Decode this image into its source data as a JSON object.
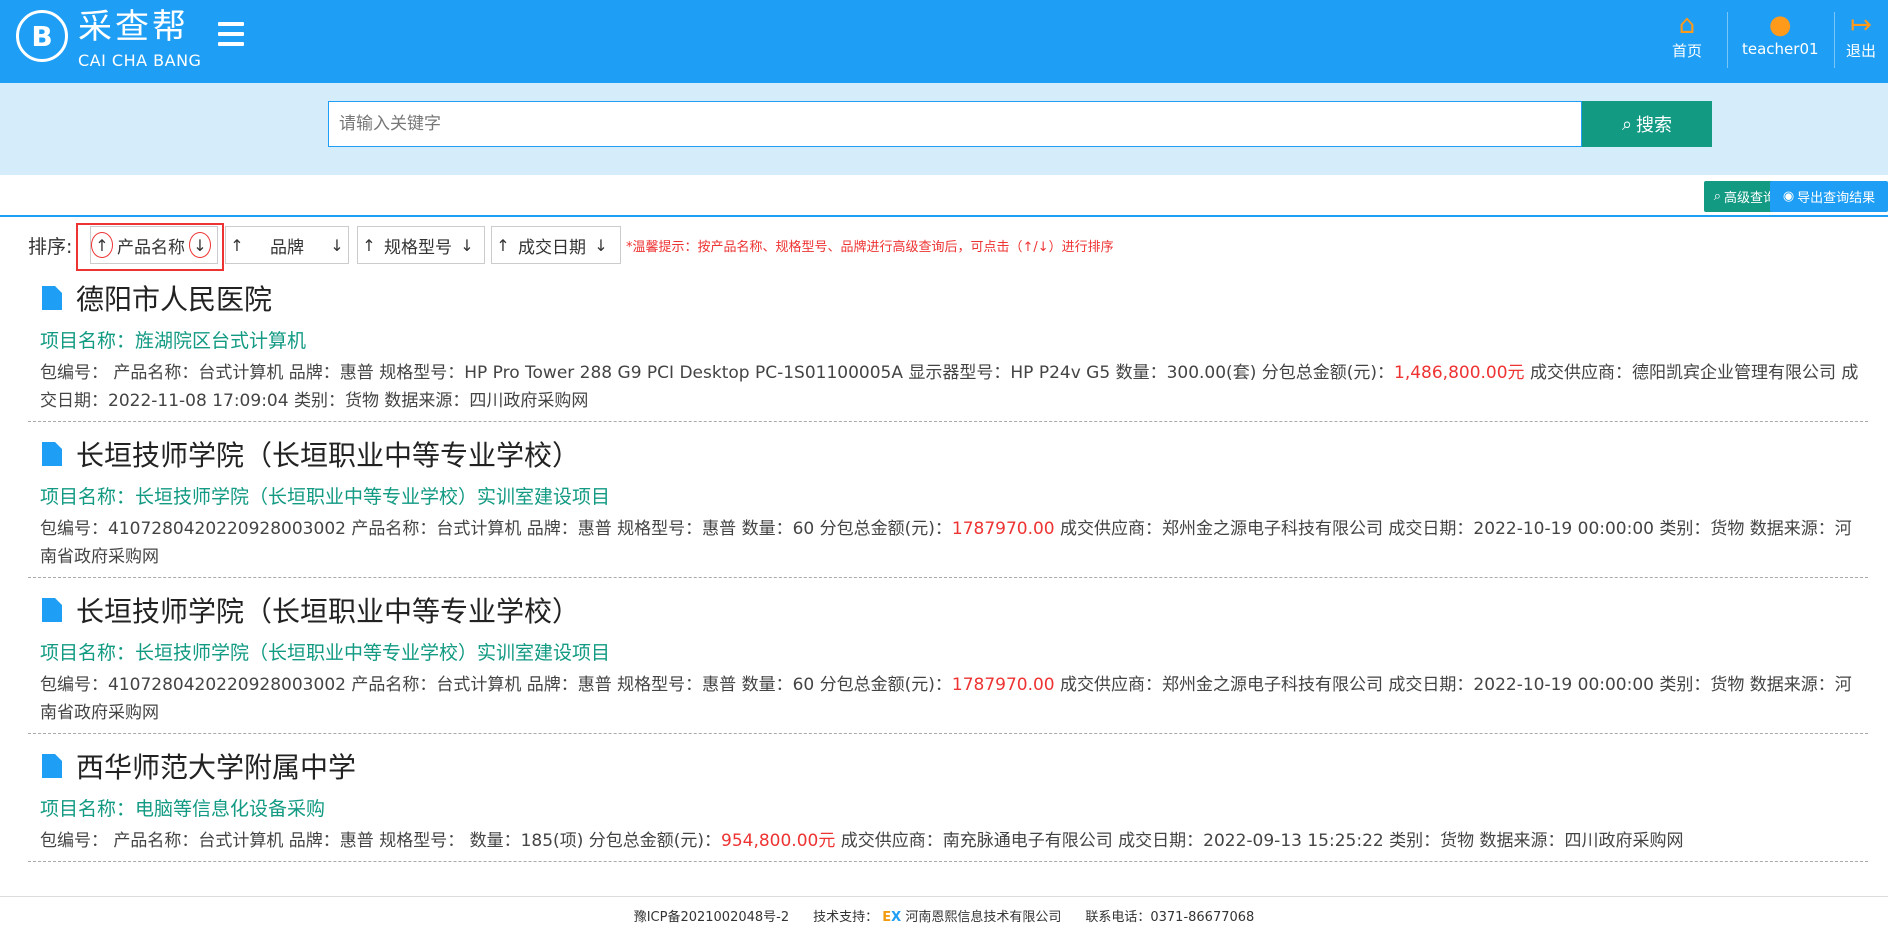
{
  "header": {
    "brand_cn": "采查帮",
    "brand_en": "CAI CHA BANG",
    "home_label": "首页",
    "user_label": "teacher01",
    "logout_label": "退出"
  },
  "search": {
    "placeholder": "请输入关键字",
    "button_label": "搜索"
  },
  "toolbar": {
    "advanced_label": "高级查询",
    "export_label": "导出查询结果"
  },
  "sort": {
    "label": "排序:",
    "options": [
      "产品名称",
      "品牌",
      "规格型号",
      "成交日期"
    ],
    "tip": "*温馨提示：按产品名称、规格型号、品牌进行高级查询后，可点击（↑/↓）进行排序"
  },
  "results": [
    {
      "title": "德阳市人民医院",
      "project": "项目名称：旌湖院区台式计算机",
      "detail_a": "包编号：  产品名称：台式计算机  品牌：惠普  规格型号：HP Pro Tower 288 G9 PCI Desktop PC-1S01100005A 显示器型号：HP P24v G5  数量：300.00(套)  分包总金额(元)：",
      "amount": "1,486,800.00元",
      "detail_b": "  成交供应商：德阳凯宾企业管理有限公司  成交日期：2022-11-08 17:09:04  类别：货物  数据来源：四川政府采购网"
    },
    {
      "title": "长垣技师学院（长垣职业中等专业学校）",
      "project": "项目名称：长垣技师学院（长垣职业中等专业学校）实训室建设项目",
      "detail_a": "包编号：4107280420220928003002  产品名称：台式计算机  品牌：惠普  规格型号：惠普  数量：60  分包总金额(元)：",
      "amount": "1787970.00",
      "detail_b": "  成交供应商：郑州金之源电子科技有限公司  成交日期：2022-10-19 00:00:00  类别：货物  数据来源：河南省政府采购网"
    },
    {
      "title": "长垣技师学院（长垣职业中等专业学校）",
      "project": "项目名称：长垣技师学院（长垣职业中等专业学校）实训室建设项目",
      "detail_a": "包编号：4107280420220928003002  产品名称：台式计算机  品牌：惠普  规格型号：惠普  数量：60  分包总金额(元)：",
      "amount": "1787970.00",
      "detail_b": "  成交供应商：郑州金之源电子科技有限公司  成交日期：2022-10-19 00:00:00  类别：货物  数据来源：河南省政府采购网"
    },
    {
      "title": "西华师范大学附属中学",
      "project": "项目名称：电脑等信息化设备采购",
      "detail_a": "包编号：  产品名称：台式计算机  品牌：惠普  规格型号：  数量：185(项)  分包总金额(元)：",
      "amount": "954,800.00元",
      "detail_b": "  成交供应商：南充脉通电子有限公司  成交日期：2022-09-13 15:25:22  类别：货物  数据来源：四川政府采购网"
    }
  ],
  "footer": {
    "icp": "豫ICP备2021002048号-2",
    "tech_label": "技术支持：",
    "company": "河南恩熙信息技术有限公司",
    "phone": "联系电话：0371-86677068"
  },
  "colors": {
    "primary": "#1e9ef4",
    "accent": "#129a83",
    "alert": "#e33333"
  }
}
